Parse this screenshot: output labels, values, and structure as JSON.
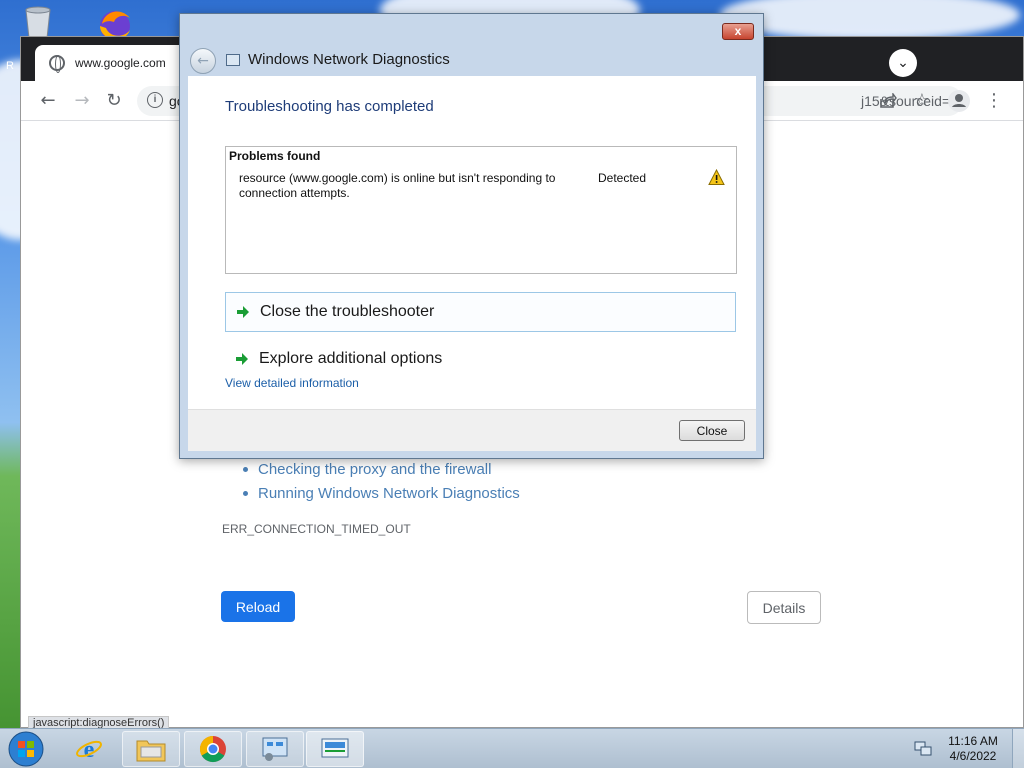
{
  "desktop": {
    "partial_label": "R"
  },
  "chrome": {
    "tab_title": "www.google.com",
    "tab_menu_icon": "chevron-down-icon",
    "address_left": "go",
    "address_right": "j15&sourceid=...",
    "status_url": "javascript:diagnoseErrors()",
    "page": {
      "suggestions": [
        "Checking the proxy and the firewall",
        "Running Windows Network Diagnostics"
      ],
      "error_code": "ERR_CONNECTION_TIMED_OUT",
      "reload_label": "Reload",
      "details_label": "Details"
    }
  },
  "dialog": {
    "title": "Windows Network Diagnostics",
    "heading": "Troubleshooting has completed",
    "problems_title": "Problems found",
    "problem": {
      "description": "resource (www.google.com) is online but isn't responding to connection attempts.",
      "status": "Detected",
      "status_icon": "warning-icon"
    },
    "options": [
      "Close the troubleshooter",
      "Explore additional options"
    ],
    "detail_link": "View detailed information",
    "close_button": "Close",
    "title_close": "x"
  },
  "taskbar": {
    "time": "11:16 AM",
    "date": "4/6/2022"
  },
  "colors": {
    "link_blue": "#4a7fb5",
    "reload_blue": "#1a73e8",
    "dialog_heading": "#1e3c78",
    "option_arrow": "#1a9d35"
  }
}
